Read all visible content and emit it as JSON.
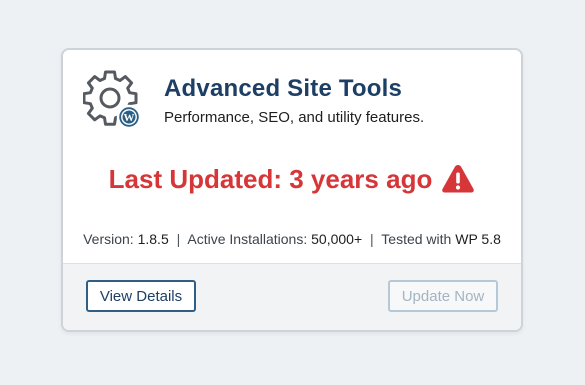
{
  "plugin": {
    "name": "Advanced Site Tools",
    "description": "Performance, SEO, and utility features.",
    "icon": "gear-icon",
    "badge_icon": "wordpress-logo-icon"
  },
  "notice": {
    "last_updated": "Last Updated: 3 years ago",
    "icon": "warning-icon",
    "color": "#d63638"
  },
  "meta": {
    "version_label": "Version:",
    "version_value": "1.8.5",
    "installs_label": "Active Installations:",
    "installs_value": "50,000+",
    "tested_label": "Tested with",
    "tested_value": "WP 5.8",
    "separator": "|"
  },
  "actions": {
    "view_details": "View Details",
    "update_now": "Update Now"
  },
  "colors": {
    "title": "#1d3f66",
    "accent": "#2f5f86",
    "warning": "#d63638"
  }
}
